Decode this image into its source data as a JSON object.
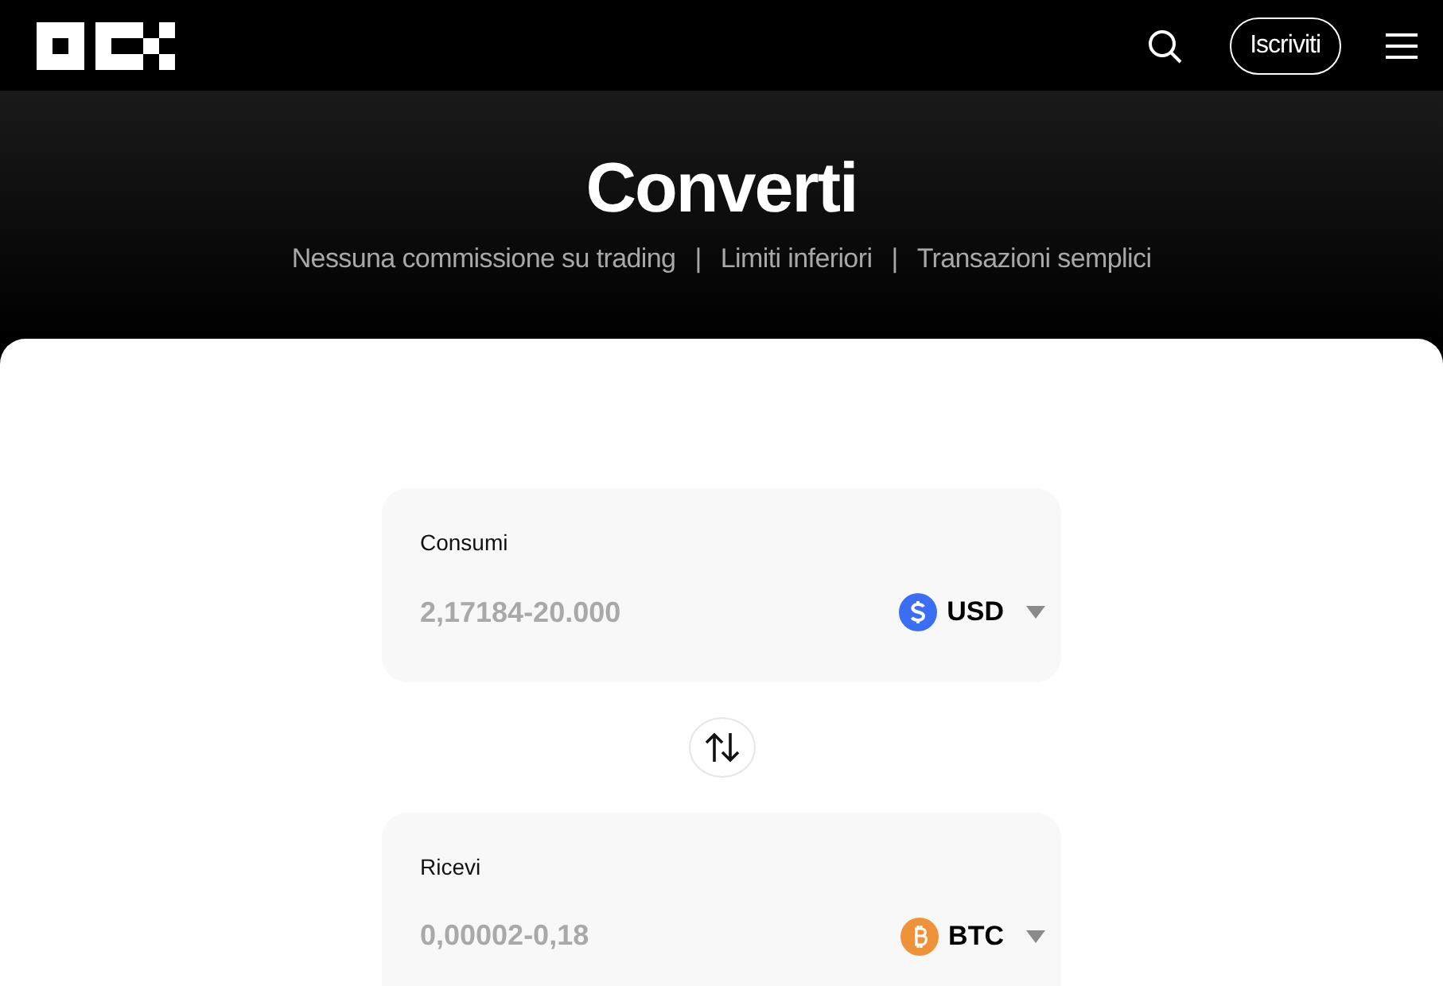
{
  "header": {
    "signup_button": "Iscriviti"
  },
  "hero": {
    "title": "Converti",
    "features": [
      "Nessuna commissione su trading",
      "Limiti inferiori",
      "Transazioni semplici"
    ],
    "separators": [
      "|",
      "|"
    ]
  },
  "converter": [
    {
      "label": "Consumi",
      "placeholder": "2,17184-20.000",
      "currency": "USD",
      "kind": "dollar",
      "color": "#3b6ef5"
    },
    {
      "label": "Ricevi",
      "placeholder": "0,00002-0,18",
      "currency": "BTC",
      "kind": "bitcoin",
      "color": "#f0923a"
    }
  ]
}
